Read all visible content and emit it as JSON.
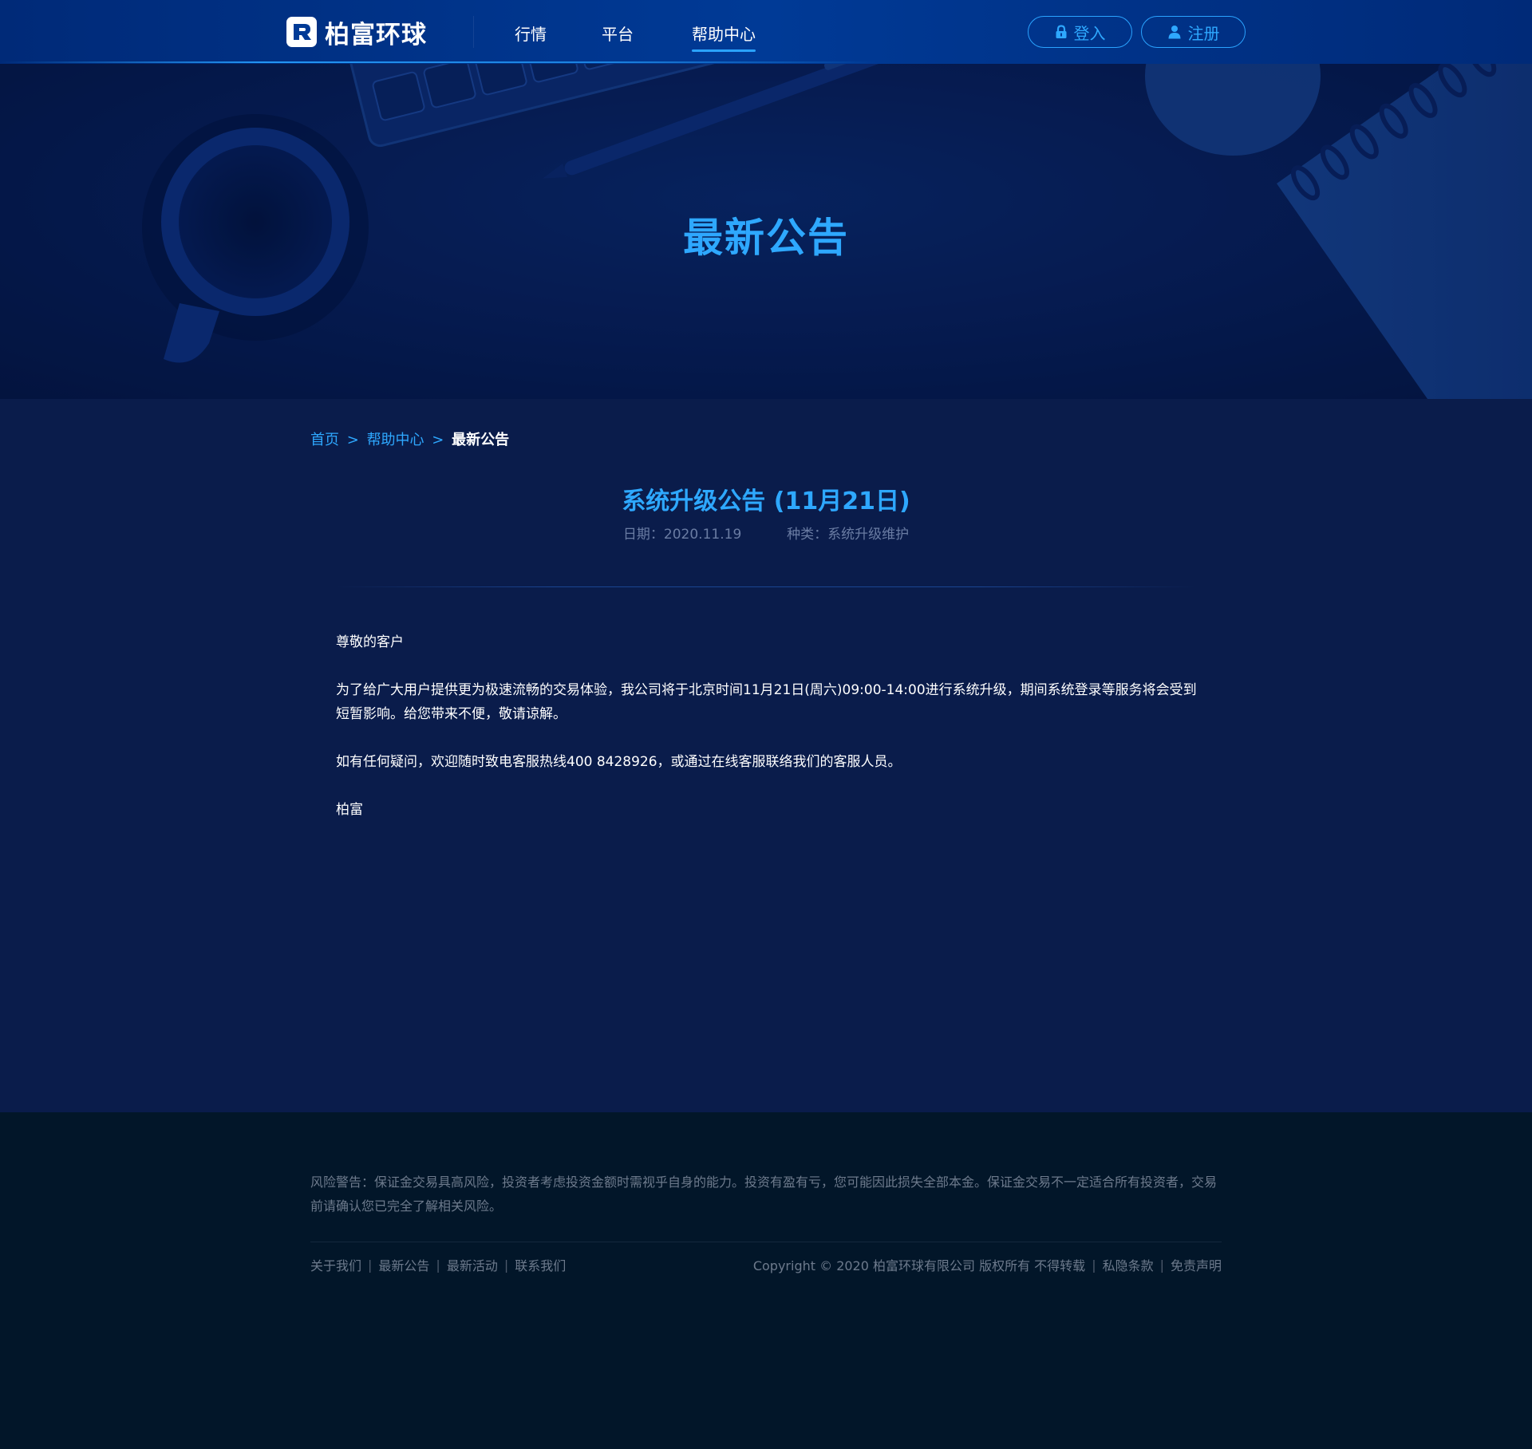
{
  "brand": {
    "name": "柏富环球"
  },
  "nav": {
    "items": [
      {
        "label": "行情"
      },
      {
        "label": "平台"
      },
      {
        "label": "帮助中心"
      }
    ],
    "active_index": 2
  },
  "auth": {
    "login_label": "登入",
    "register_label": "注册"
  },
  "hero": {
    "title": "最新公告"
  },
  "breadcrumb": {
    "home": "首页",
    "help": "帮助中心",
    "current": "最新公告",
    "separator": ">"
  },
  "article": {
    "title": "系统升级公告 (11月21日)",
    "date_label": "日期：",
    "date": "2020.11.19",
    "category_label": "种类：",
    "category": "系统升级维护",
    "paragraphs": [
      "尊敬的客户",
      "为了给广大用户提供更为极速流畅的交易体验，我公司将于北京时间11月21日(周六)09:00-14:00进行系统升级，期间系统登录等服务将会受到短暂影响。给您带来不便，敬请谅解。",
      "如有任何疑问，欢迎随时致电客服热线400 8428926，或通过在线客服联络我们的客服人员。",
      "柏富"
    ]
  },
  "footer": {
    "risk_warning": "风险警告：保证金交易具高风险，投资者考虑投资金额时需视乎自身的能力。投资有盈有亏，您可能因此损失全部本金。保证金交易不一定适合所有投资者，交易前请确认您已完全了解相关风险。",
    "links": [
      "关于我们",
      "最新公告",
      "最新活动",
      "联系我们"
    ],
    "separator": "|",
    "copyright": "Copyright © 2020 柏富环球有限公司  版权所有 不得转载",
    "privacy": "私隐条款",
    "disclaimer": "免责声明"
  },
  "colors": {
    "accent": "#2ea8ff",
    "header_bg": "#003a96",
    "content_bg": "#0a1c4b",
    "footer_bg": "#021629"
  },
  "icons": {
    "login": "lock-icon",
    "register": "user-icon",
    "logo": "logo-mark-icon"
  }
}
